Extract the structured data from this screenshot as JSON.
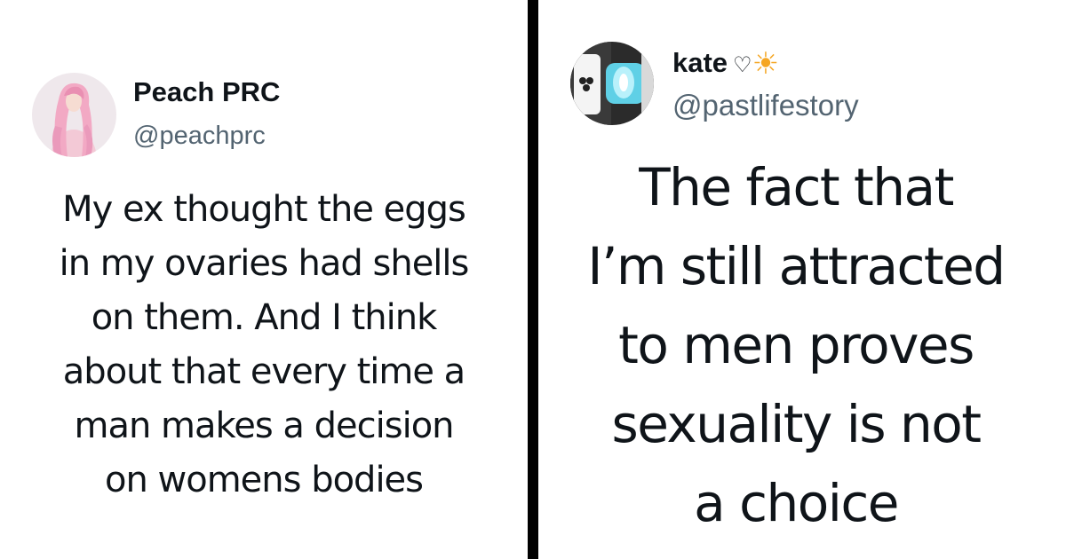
{
  "tweets": [
    {
      "display_name": "Peach PRC",
      "handle": "@peachprc",
      "text": "My ex thought the eggs\nin my ovaries had shells\non them. And I think\nabout that every time a\nman makes a decision\non womens bodies",
      "avatar_icon": "profile-photo-pink-hair"
    },
    {
      "display_name": "kate",
      "name_decoration": "♡",
      "name_emoji": "☀",
      "handle": "@pastlifestory",
      "text": "The fact that\nI’m still attracted\nto men proves\nsexuality is not\na choice",
      "avatar_icon": "profile-photo-phone-blue"
    }
  ],
  "colors": {
    "divider": "#000000",
    "name": "#0f1419",
    "handle": "#536471",
    "background": "#ffffff"
  }
}
